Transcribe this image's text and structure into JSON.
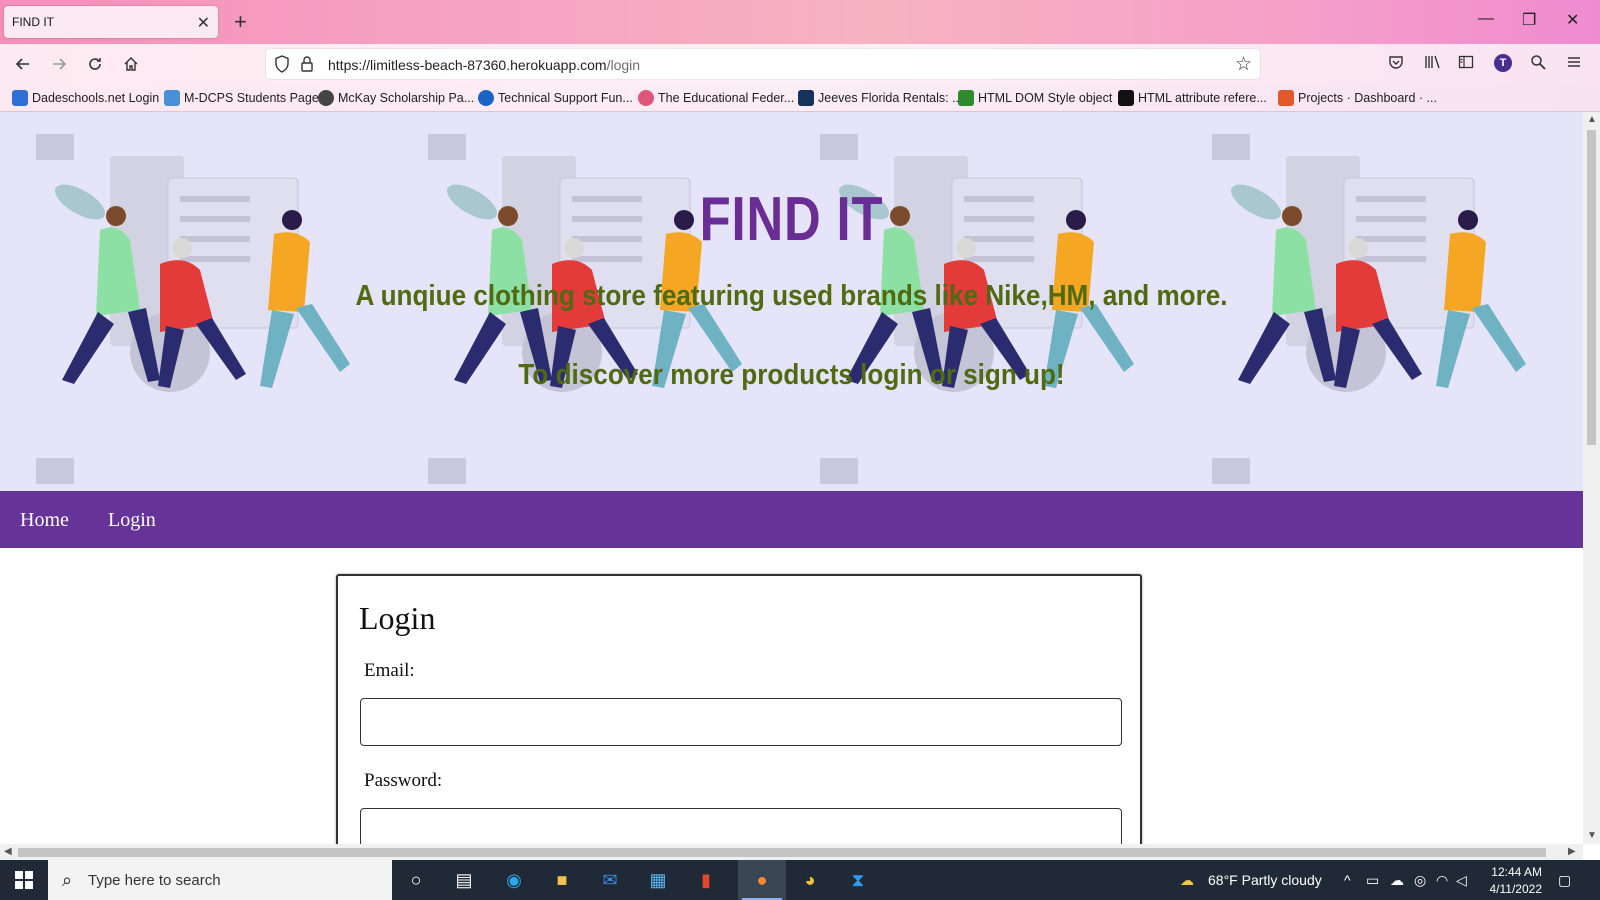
{
  "browser": {
    "tab_title": "FIND IT",
    "url_host": "https://limitless-beach-87360.herokuapp.com",
    "url_path": "/login",
    "profile_initial": "T"
  },
  "bookmarks": [
    {
      "label": "Dadeschools.net Login",
      "color": "#2d6fd6"
    },
    {
      "label": "M-DCPS Students Page",
      "color": "#4a90d9"
    },
    {
      "label": "McKay Scholarship Pa...",
      "color": "#444444"
    },
    {
      "label": "Technical Support Fun...",
      "color": "#1a64c8"
    },
    {
      "label": "The Educational Feder...",
      "color": "#e0567a"
    },
    {
      "label": "Jeeves Florida Rentals: ...",
      "color": "#14325c"
    },
    {
      "label": "HTML DOM Style object",
      "color": "#2e8b2e"
    },
    {
      "label": "HTML attribute refere...",
      "color": "#111111"
    },
    {
      "label": "Projects · Dashboard · ...",
      "color": "#e2582b"
    }
  ],
  "hero": {
    "title": "FIND IT",
    "subtitle1": "A unqiue clothing store featuring used brands like Nike,HM, and more.",
    "subtitle2": "To discover more products login or sign up!"
  },
  "nav": {
    "home": "Home",
    "login": "Login"
  },
  "login_form": {
    "heading": "Login",
    "email_label": "Email:",
    "email_value": "",
    "password_label": "Password:",
    "password_value": ""
  },
  "taskbar": {
    "search_placeholder": "Type here to search",
    "weather": "68°F  Partly cloudy",
    "time": "12:44 AM",
    "date": "4/11/2022"
  },
  "colors": {
    "hero_bg": "#e6e4f8",
    "title": "#6a2d95",
    "subtitle": "#4f6a10",
    "nav_bg": "#663399"
  }
}
